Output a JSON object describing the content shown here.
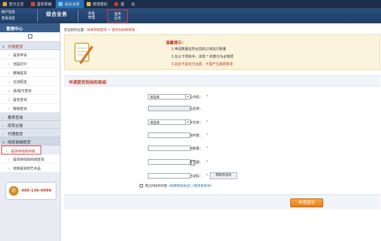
{
  "topnav": [
    {
      "label": "官方主页",
      "icon": "home-icon",
      "active": false
    },
    {
      "label": "直供系统",
      "icon": "system-icon",
      "active": false
    },
    {
      "label": "综合业务",
      "icon": "business-icon",
      "active": true
    },
    {
      "label": "修改密码",
      "icon": "key-icon",
      "active": false
    },
    {
      "label": "退",
      "icon": "power-icon",
      "active": false
    },
    {
      "label": "出",
      "icon": "",
      "active": false
    }
  ],
  "header": {
    "user_info": "用户信息",
    "view_messages": "查看消息",
    "module_title": "综合业务",
    "subtabs": [
      {
        "line1": "资金",
        "line2": "管理"
      },
      {
        "line1": "直供",
        "line2": "业务"
      }
    ]
  },
  "sidebar": {
    "title": "管理中心",
    "groups": [
      {
        "label": "文物提货",
        "open": true,
        "items": [
          "提货申请",
          "自提打印",
          "撤销提货",
          "在线配送",
          "退/提与查询",
          "提货查询",
          "撤销查询"
        ]
      },
      {
        "label": "报表查询",
        "open": false,
        "items": []
      },
      {
        "label": "库转交易",
        "open": false,
        "items": []
      },
      {
        "label": "代理提货",
        "open": false,
        "items": []
      },
      {
        "label": "线库商城提货",
        "open": true,
        "items": [
          "提货到线库商城",
          "提货到线库商城查询",
          "线库提货到艺术品"
        ]
      }
    ],
    "highlighted_item": "提货到线库商城",
    "phone": "400-136-9999"
  },
  "breadcrumb": {
    "prefix": "您当前的位置：",
    "path": "线库商城提货 > 提货到线库商城"
  },
  "tips": {
    "title": "温馨提示：",
    "lines": [
      "1.申请数量应符合您的订单执行数量",
      "2.在以下项目中，出现 * 的部分为必填项",
      "3.如应不需支付运费，不需产生邮费账单"
    ]
  },
  "form": {
    "section_title": "申请提货到线库商城：",
    "fields": [
      {
        "label": "商品代码：",
        "required": true,
        "type": "select",
        "value": "请选择"
      },
      {
        "label": "商品名称：",
        "required": false,
        "type": "readonly",
        "value": ""
      },
      {
        "label": "交货仓库：",
        "required": true,
        "type": "select",
        "value": "请选择"
      },
      {
        "label": "文物件数：",
        "required": true,
        "type": "text",
        "value": ""
      },
      {
        "label": "文物数量：",
        "required": true,
        "type": "text",
        "value": ""
      },
      {
        "label": "提货日期：",
        "required": true,
        "type": "date",
        "value": ""
      },
      {
        "label": "验证码：",
        "required": true,
        "type": "captcha",
        "value": ""
      }
    ],
    "captcha_button": "获取验证码",
    "agree_text": "我已阅读并同意",
    "agree_link": "《线库转会协议》",
    "agree_link2": "《提货承诺书》",
    "submit": "申请提交"
  }
}
